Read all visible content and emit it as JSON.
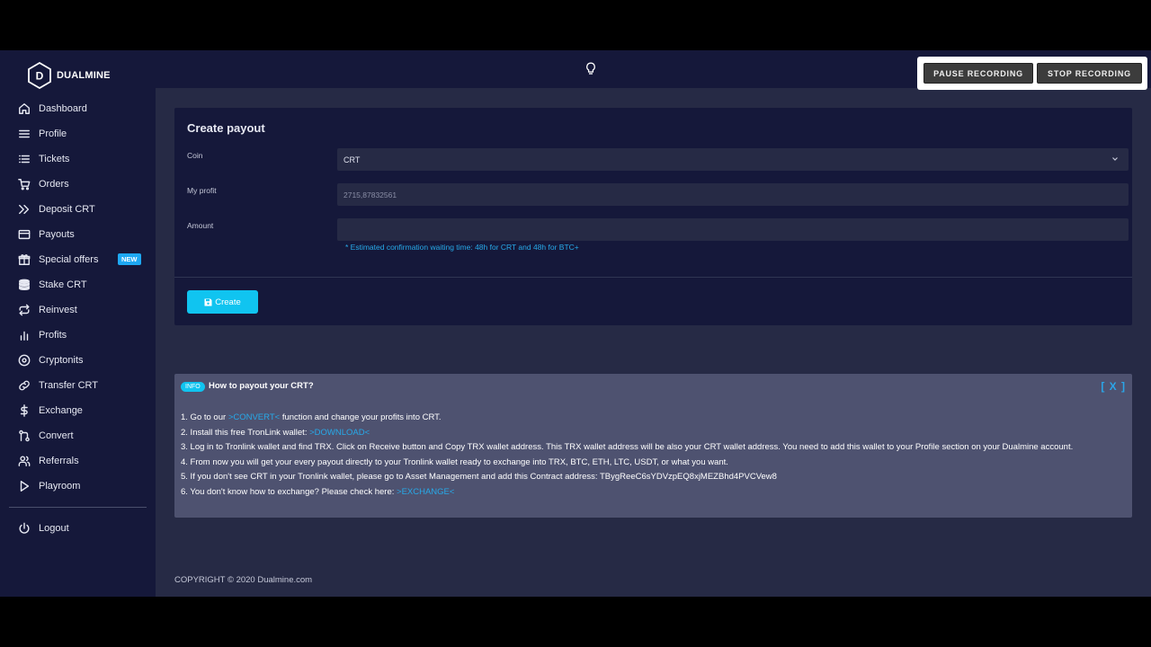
{
  "brand": {
    "name": "DUALMINE",
    "logo_letter": "D"
  },
  "sidebar": {
    "items": [
      {
        "label": "Dashboard",
        "icon": "home-icon"
      },
      {
        "label": "Profile",
        "icon": "menu-icon"
      },
      {
        "label": "Tickets",
        "icon": "list-icon"
      },
      {
        "label": "Orders",
        "icon": "cart-icon"
      },
      {
        "label": "Deposit CRT",
        "icon": "double-chevron-icon"
      },
      {
        "label": "Payouts",
        "icon": "credit-card-icon"
      },
      {
        "label": "Special offers",
        "icon": "gift-icon",
        "badge": "NEW"
      },
      {
        "label": "Stake CRT",
        "icon": "database-icon"
      },
      {
        "label": "Reinvest",
        "icon": "repeat-icon"
      },
      {
        "label": "Profits",
        "icon": "bar-chart-icon"
      },
      {
        "label": "Cryptonits",
        "icon": "disc-icon"
      },
      {
        "label": "Transfer CRT",
        "icon": "link-icon"
      },
      {
        "label": "Exchange",
        "icon": "dollar-icon"
      },
      {
        "label": "Convert",
        "icon": "git-pull-icon"
      },
      {
        "label": "Referrals",
        "icon": "users-icon"
      },
      {
        "label": "Playroom",
        "icon": "play-icon"
      }
    ],
    "logout": {
      "label": "Logout",
      "icon": "power-icon"
    }
  },
  "topbar": {
    "pause_label": "PAUSE RECORDING",
    "stop_label": "STOP RECORDING"
  },
  "payout": {
    "title": "Create payout",
    "coin_label": "Coin",
    "coin_value": "CRT",
    "profit_label": "My profit",
    "profit_value": "2715,87832561",
    "amount_label": "Amount",
    "amount_value": "",
    "hint": "* Estimated confirmation waiting time: 48h for CRT and 48h for BTC+",
    "create_label": "Create"
  },
  "info": {
    "badge": "INFO",
    "title": "How to payout your CRT?",
    "close": "[ X ]",
    "line1_pre": "1. Go to our ",
    "line1_link": ">CONVERT<",
    "line1_post": " function and change your profits into CRT.",
    "line2_pre": "2. Install this free TronLink wallet: ",
    "line2_link": ">DOWNLOAD<",
    "line3": "3. Log in to Tronlink wallet and find TRX. Click on Receive button and Copy TRX wallet address. This TRX wallet address will be also your CRT wallet address. You need to add this wallet to your Profile section on your Dualmine account.",
    "line4": "4. From now you will get your every payout directly to your Tronlink wallet ready to exchange into TRX, BTC, ETH, LTC, USDT, or what you want.",
    "line5": "5. If you don't see CRT in your Tronlink wallet, please go to Asset Management and add this Contract address: TBygReeC6sYDVzpEQ8xjMEZBhd4PVCVew8",
    "line6_pre": "6. You don't know how to exchange? Please check here: ",
    "line6_link": ">EXCHANGE<"
  },
  "footer": {
    "copyright": "COPYRIGHT © 2020 Dualmine.com"
  },
  "colors": {
    "accent": "#10c4f0",
    "link": "#27a9e8",
    "sidebar_bg": "#15183a",
    "content_bg": "#262a45"
  }
}
